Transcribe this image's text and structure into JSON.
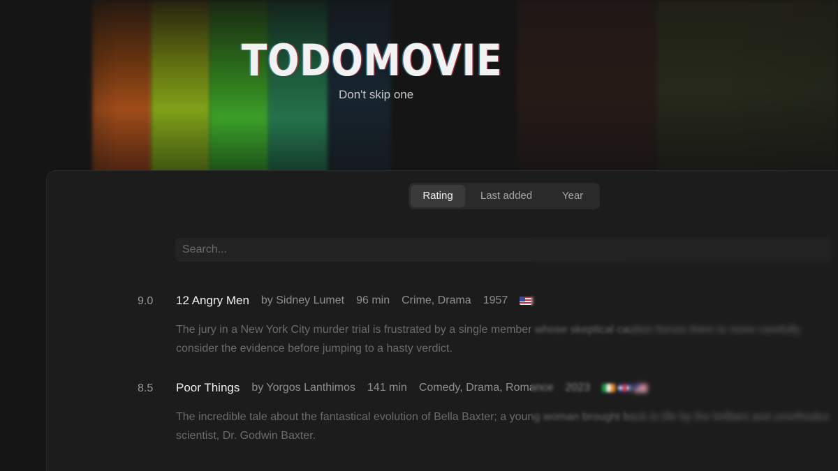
{
  "header": {
    "logo_text": "TODOMOVIE",
    "tagline": "Don't skip one"
  },
  "tabs": [
    {
      "label": "Rating",
      "active": true
    },
    {
      "label": "Last added",
      "active": false
    },
    {
      "label": "Year",
      "active": false
    }
  ],
  "search": {
    "placeholder": "Search...",
    "value": ""
  },
  "movies": [
    {
      "rating": "9.0",
      "title": "12 Angry Men",
      "director": "by Sidney Lumet",
      "duration": "96 min",
      "genres": "Crime, Drama",
      "year": "1957",
      "flags": [
        "flag-us-icon"
      ],
      "description": "The jury in a New York City murder trial is frustrated by a single member whose skeptical caution forces them to more carefully consider the evidence before jumping to a hasty verdict."
    },
    {
      "rating": "8.5",
      "title": "Poor Things",
      "director": "by Yorgos Lanthimos",
      "duration": "141 min",
      "genres": "Comedy, Drama, Romance",
      "year": "2023",
      "flags": [
        "flag-ie-icon",
        "flag-gb-icon",
        "flag-us-icon"
      ],
      "description": "The incredible tale about the fantastical evolution of Bella Baxter; a young woman brought back to life by the brilliant and unorthodox scientist, Dr. Godwin Baxter."
    }
  ],
  "colors": {
    "background": "#151515",
    "card": "#1c1c1c",
    "tab_active": "#3a3a3a",
    "text_primary": "#f2f2f2",
    "text_muted": "#8e8e8e"
  }
}
